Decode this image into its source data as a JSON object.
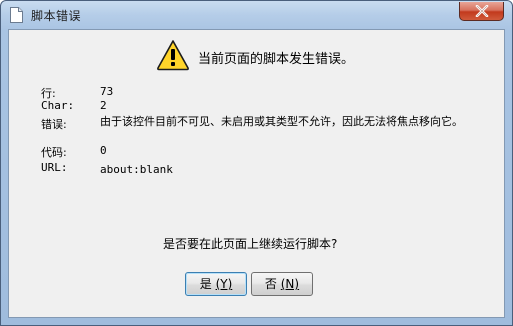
{
  "window": {
    "title": "脚本错误",
    "close_icon": "close-icon"
  },
  "header": {
    "icon": "warning-icon",
    "message": "当前页面的脚本发生错误。"
  },
  "details": {
    "line": {
      "label": "行:",
      "value": "73"
    },
    "char": {
      "label": "Char:",
      "value": "2"
    },
    "error": {
      "label": "错误:",
      "value": "由于该控件目前不可见、未启用或其类型不允许，因此无法将焦点移向它。"
    },
    "code": {
      "label": "代码:",
      "value": "0"
    },
    "url": {
      "label": "URL:",
      "value": "about:blank"
    }
  },
  "prompt": "是否要在此页面上继续运行脚本?",
  "buttons": {
    "yes": {
      "text": "是",
      "accel": "(Y)"
    },
    "no": {
      "text": "否",
      "accel": "(N)"
    }
  },
  "colors": {
    "title_gradient_top": "#c9dcf0",
    "content_bg": "#f0f0f0",
    "close_button": "#c2391d",
    "warning_yellow": "#ffd42a",
    "default_button_border": "#3c7fb1"
  }
}
